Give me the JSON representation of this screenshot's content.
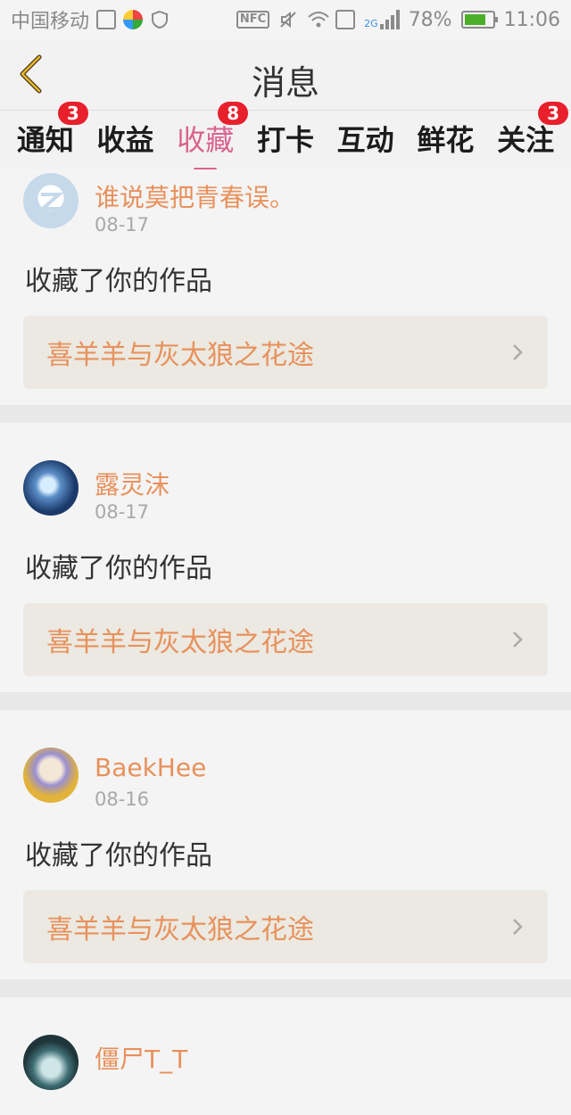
{
  "statusbar": {
    "carrier": "中国移动",
    "nfc": "NFC",
    "net": "2G",
    "battery": "78%",
    "time": "11:06"
  },
  "header": {
    "title": "消息"
  },
  "tabs": [
    {
      "label": "通知",
      "badge": "3"
    },
    {
      "label": "收益",
      "badge": ""
    },
    {
      "label": "收藏",
      "badge": "8"
    },
    {
      "label": "打卡",
      "badge": ""
    },
    {
      "label": "互动",
      "badge": ""
    },
    {
      "label": "鲜花",
      "badge": ""
    },
    {
      "label": "关注",
      "badge": "3"
    }
  ],
  "active_tab": "收藏",
  "feed": [
    {
      "user": "谁说莫把青春误。",
      "date": "08-17",
      "action": "收藏了你的作品",
      "work": "喜羊羊与灰太狼之花途"
    },
    {
      "user": "露灵沫",
      "date": "08-17",
      "action": "收藏了你的作品",
      "work": "喜羊羊与灰太狼之花途"
    },
    {
      "user": "BaekHee",
      "date": "08-16",
      "action": "收藏了你的作品",
      "work": "喜羊羊与灰太狼之花途"
    },
    {
      "user": "僵尸T_T",
      "date": "",
      "action": "",
      "work": ""
    }
  ],
  "colors": {
    "accent_pink": "#d9638e",
    "accent_orange": "#e8915c",
    "badge_red": "#e8202c"
  }
}
